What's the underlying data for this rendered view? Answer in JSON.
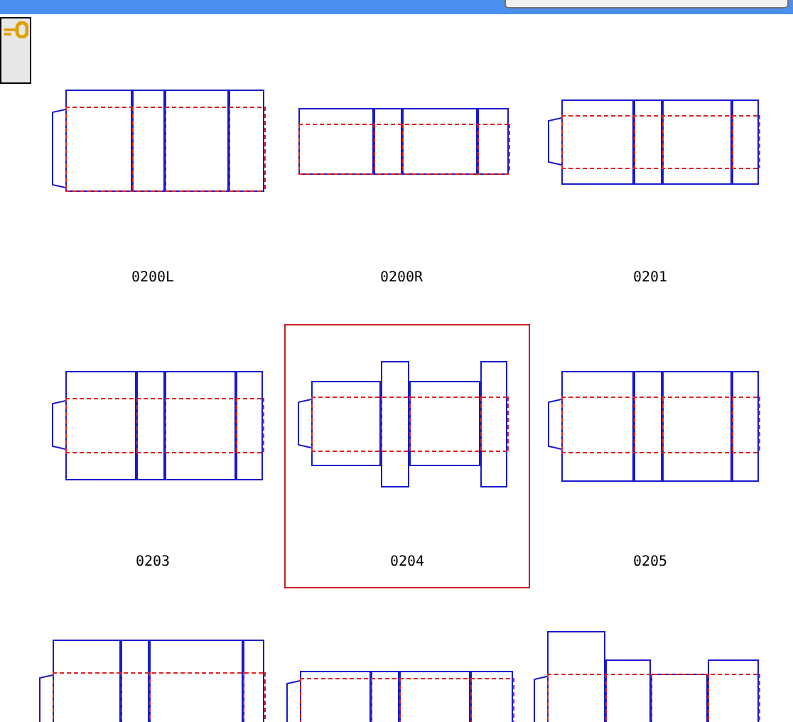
{
  "templates": [
    {
      "label": "0200L",
      "kind": "tray-tall",
      "selected": false
    },
    {
      "label": "0200R",
      "kind": "tray-flat",
      "selected": false
    },
    {
      "label": "0201",
      "kind": "slotted",
      "selected": false
    },
    {
      "label": "0203",
      "kind": "overlap",
      "selected": false
    },
    {
      "label": "0204",
      "kind": "center-special",
      "selected": true
    },
    {
      "label": "0205",
      "kind": "full-overlap",
      "selected": false
    },
    {
      "kind": "double-flap",
      "selected": false
    },
    {
      "kind": "shallow",
      "selected": false
    },
    {
      "kind": "tuck-top",
      "selected": false
    }
  ]
}
